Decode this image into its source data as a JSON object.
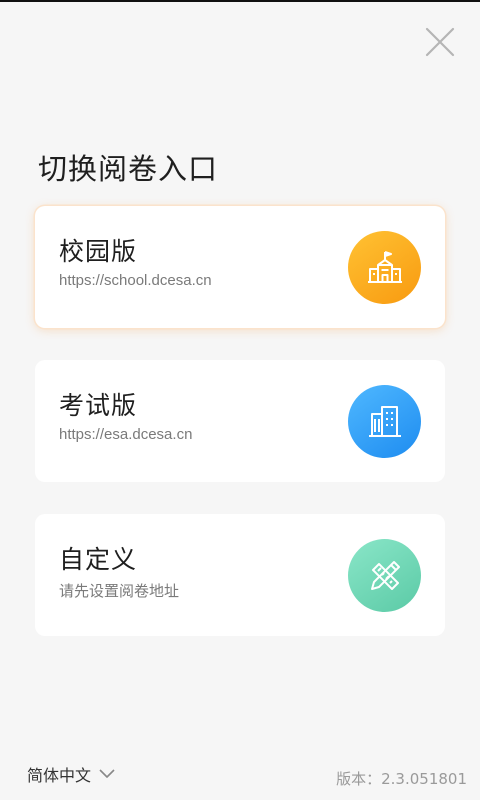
{
  "header": {
    "close_icon": "close-icon",
    "title": "切换阅卷入口"
  },
  "cards": [
    {
      "name": "校园版",
      "subtitle": "https://school.dcesa.cn",
      "icon": "school-building-icon",
      "color": "#f9a91a",
      "selected": true
    },
    {
      "name": "考试版",
      "subtitle": "https://esa.dcesa.cn",
      "icon": "office-building-icon",
      "color": "#2f9cf6",
      "selected": false
    },
    {
      "name": "自定义",
      "subtitle": "请先设置阅卷地址",
      "icon": "pencil-ruler-icon",
      "color": "#6fd4b3",
      "selected": false
    }
  ],
  "footer": {
    "language": "简体中文",
    "language_icon": "chevron-down-icon",
    "version": "版本：2.3.051801"
  }
}
